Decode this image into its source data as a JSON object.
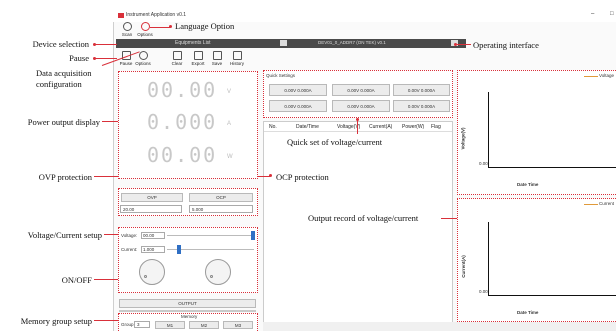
{
  "window": {
    "title": "Instrument Application v0.1",
    "minimize_glyph": "–",
    "close_glyph": "□"
  },
  "toolbar_top": {
    "items": [
      {
        "label": "Scan"
      },
      {
        "label": "Options"
      }
    ]
  },
  "equipment_bar": {
    "title": "Equipments List",
    "device": "DEV01_0_ADDR7 (ON TEK) v0.1"
  },
  "toolbar_second": {
    "items": [
      {
        "label": "Pause"
      },
      {
        "label": "Options"
      },
      {
        "label": "Clear"
      },
      {
        "label": "Export"
      },
      {
        "label": "Save"
      },
      {
        "label": "History"
      }
    ]
  },
  "display": {
    "voltage": "00.00",
    "voltage_unit": "V",
    "current": "0.000",
    "current_unit": "A",
    "power": "00.00",
    "power_unit": "W"
  },
  "protection": {
    "ovp_label": "OVP",
    "ocp_label": "OCP",
    "ovp_value": "20.00",
    "ocp_value": "5.000"
  },
  "setup": {
    "voltage_label": "Voltage:",
    "voltage_value": "00.00",
    "current_label": "Current:",
    "current_value": "1.000",
    "output_label": "OUTPUT"
  },
  "memory": {
    "title": "Memory",
    "group_label": "Group",
    "group_value": "3",
    "m1": "M1",
    "m2": "M2",
    "m3": "M3"
  },
  "quick": {
    "title": "Quick Settings",
    "buttons": [
      "0.00V 0.000A",
      "0.00V 0.000A",
      "0.00V 0.000A",
      "0.00V 0.000A",
      "0.00V 0.000A",
      "0.00V 0.000A"
    ]
  },
  "record": {
    "columns": [
      "No.",
      "Date/Time",
      "Voltage(V)",
      "Current(A)",
      "Power(W)",
      "Flag"
    ]
  },
  "charts": {
    "voltage": {
      "ylabel": "Voltage(V)",
      "xlabel": "Date Time",
      "tick": "0.00",
      "legend": "Voltage"
    },
    "current": {
      "ylabel": "Current(A)",
      "xlabel": "Date Time",
      "tick": "0.00",
      "legend": "Current"
    }
  },
  "annotations": {
    "language_option": "Language Option",
    "operating_interface": "Operating interface",
    "device_selection": "Device selection",
    "pause": "Pause",
    "data_acquisition_1": "Data acquisition",
    "data_acquisition_2": "configuration",
    "power_output_display": "Power output display",
    "ovp_protection": "OVP protection",
    "ocp_protection": "OCP protection",
    "voltage_current_setup": "Voltage/Current setup",
    "on_off": "ON/OFF",
    "memory_group_setup": "Memory group setup",
    "quick_set": "Quick set of voltage/current",
    "output_record": "Output record of voltage/current"
  },
  "colors": {
    "annotation_red": "#d9303a",
    "dark_bar": "#4a4a4a",
    "slider_blue": "#2f6fc4",
    "legend_orange": "#e09a3a"
  }
}
